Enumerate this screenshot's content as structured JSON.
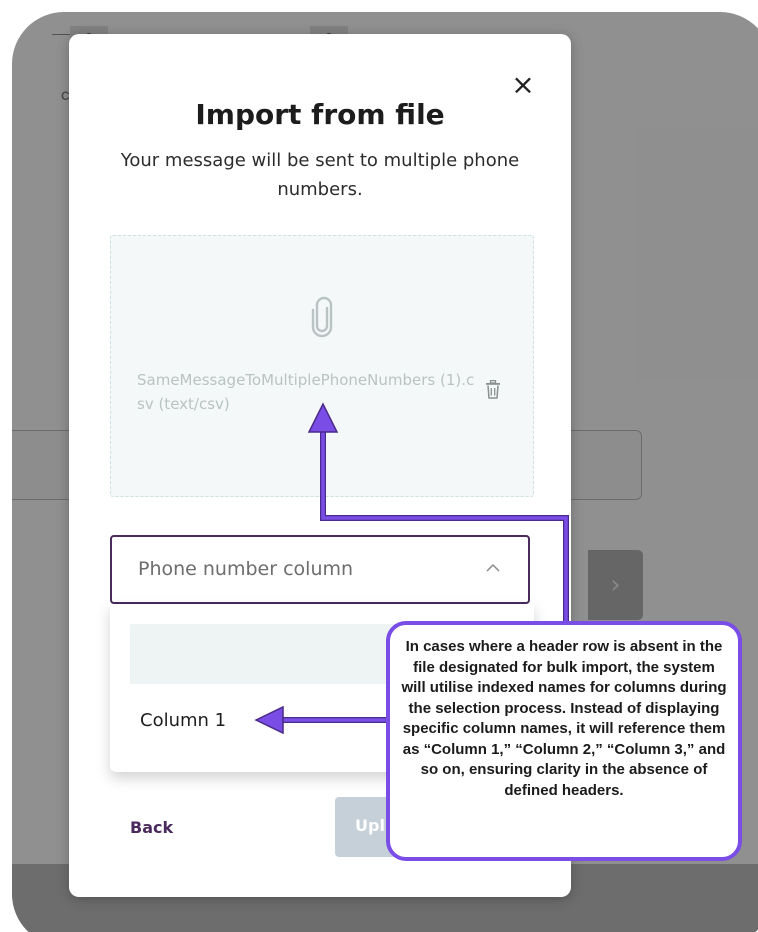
{
  "background": {
    "steps": [
      "2",
      "3"
    ],
    "partial_label": "Co"
  },
  "modal": {
    "close_symbol": "×",
    "title": "Import from file",
    "subtitle": "Your message will be sent to multiple phone numbers.",
    "dropzone": {
      "file_label": "SameMessageToMultiplePhoneNumbers (1).csv (text/csv)",
      "icons": [
        "paperclip-icon",
        "trash-icon"
      ]
    },
    "select": {
      "placeholder": "Phone number column",
      "icon": "chevron-up-icon",
      "options": [
        "",
        "Column 1"
      ]
    },
    "footer": {
      "back_label": "Back",
      "upload_label": "Upl"
    }
  },
  "annotation": {
    "text": "In cases where a header row is absent in the file designated for bulk import, the system will utilise indexed names for columns during the selection process. Instead of displaying specific column names, it will reference them as “Column 1,” “Column 2,” “Column 3,” and so on, ensuring clarity in the absence of defined headers.",
    "accent_color": "#7a4ee6"
  },
  "colors": {
    "brand_purple": "#4b2a5e",
    "overlay_gray": "#8a8a8a",
    "dropzone_bg": "#f4f8f8"
  }
}
